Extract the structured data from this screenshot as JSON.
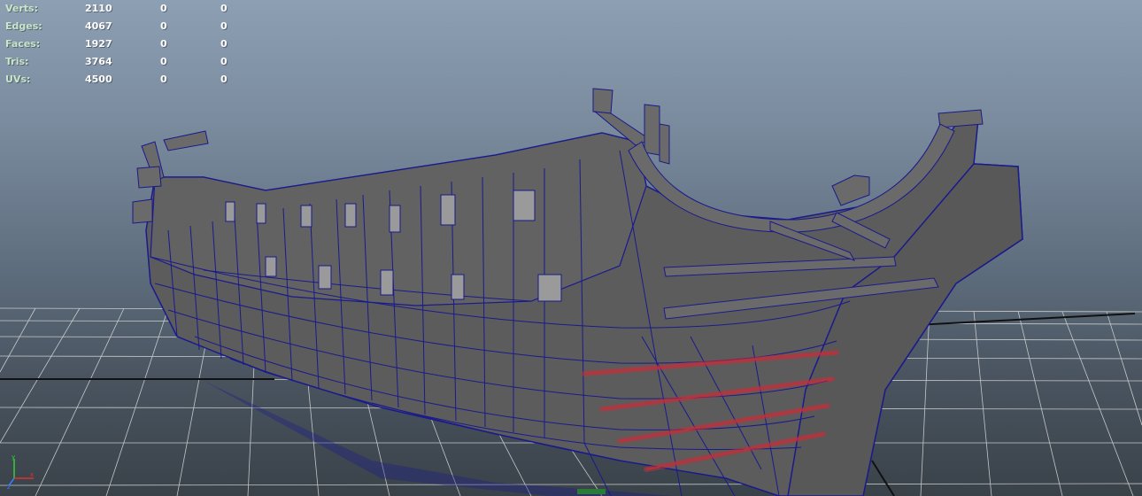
{
  "hud": {
    "rows": [
      {
        "label": "Verts:",
        "total": "2110",
        "selected": "0",
        "extra": "0"
      },
      {
        "label": "Edges:",
        "total": "4067",
        "selected": "0",
        "extra": "0"
      },
      {
        "label": "Faces:",
        "total": "1927",
        "selected": "0",
        "extra": "0"
      },
      {
        "label": "Tris:",
        "total": "3764",
        "selected": "0",
        "extra": "0"
      },
      {
        "label": "UVs:",
        "total": "4500",
        "selected": "0",
        "extra": "0"
      }
    ]
  },
  "axis": {
    "x_label": "x",
    "y_label": "y",
    "z_label": "z",
    "x_color": "#e03030",
    "y_color": "#30d030",
    "z_color": "#3080ff"
  },
  "viewport": {
    "background_top": "#8d9fb3",
    "background_bottom": "#3a4249",
    "mesh_color": "#5a5a5a",
    "wire_color": "#1a1a8c",
    "grid_color": "#dcdcdc",
    "highlight_color": "#c0303a"
  }
}
